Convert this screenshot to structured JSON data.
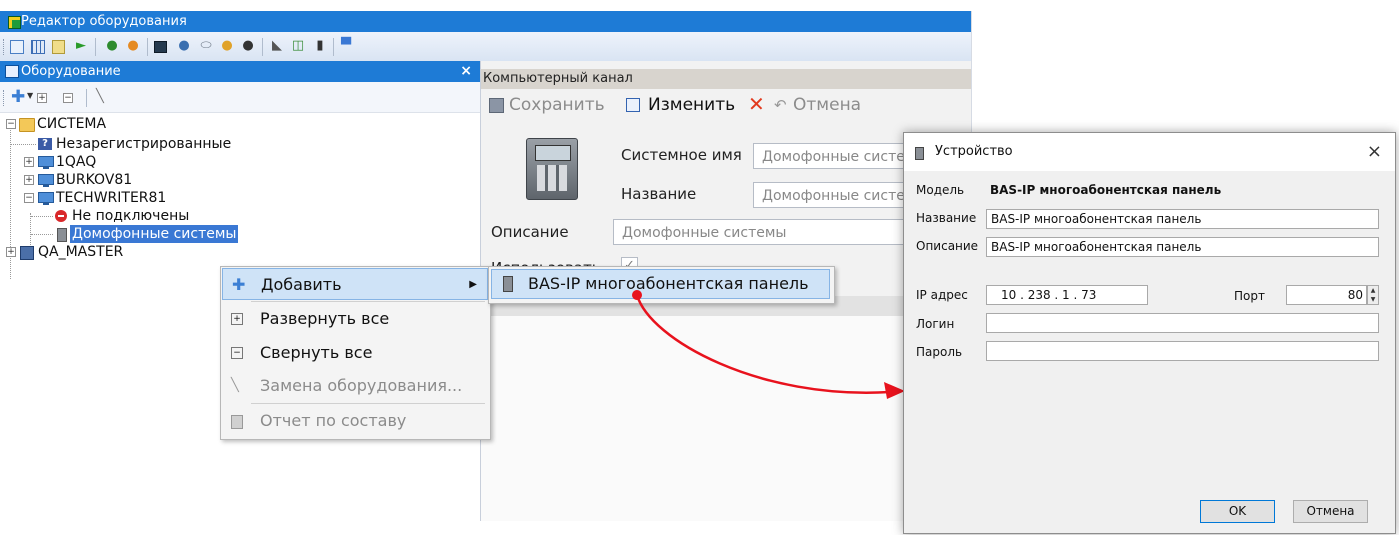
{
  "window": {
    "title": "Редактор оборудования",
    "icon": "equipment-editor-icon"
  },
  "toolbar": {
    "icons": [
      "table-icon",
      "grid-icon",
      "notes-icon",
      "flag-icon",
      "user-icon",
      "group-icon",
      "monitor-icon",
      "users-icon",
      "drive-icon",
      "person-icon",
      "person-dark-icon",
      "tool-icon",
      "card-icon",
      "phone-icon",
      "computer-icon"
    ]
  },
  "left_panel": {
    "title": "Оборудование",
    "close": "×",
    "tree": {
      "root": "СИСТЕМА",
      "unregistered": "Незарегистрированные",
      "pc1": "1QAQ",
      "pc2": "BURKOV81",
      "pc3": "TECHWRITER81",
      "not_connected": "Не подключены",
      "intercom": "Домофонные системы",
      "server": "QA_MASTER"
    }
  },
  "right_panel": {
    "header": "Компьютерный канал",
    "save": "Сохранить",
    "edit": "Изменить",
    "cancel": "Отмена",
    "system_name_label": "Системное имя",
    "system_name_value": "Домофонные системы",
    "name_label": "Название",
    "name_value": "Домофонные системы",
    "description_label": "Описание",
    "description_value": "Домофонные системы",
    "use_label": "Использовать",
    "use_checked": "✓"
  },
  "context_menu": {
    "items": [
      {
        "label": "Добавить",
        "arrow": "▶"
      },
      {
        "label": "Развернуть все"
      },
      {
        "label": "Свернуть все"
      },
      {
        "label": "Замена оборудования..."
      },
      {
        "label": "Отчет по составу"
      }
    ],
    "submenu_item": "BAS-IP многоабонентская панель"
  },
  "dialog": {
    "title": "Устройство",
    "close": "×",
    "model_label": "Модель",
    "model_value": "BAS-IP многоабонентская панель",
    "name_label": "Название",
    "name_value": "BAS-IP многоабонентская панель",
    "description_label": "Описание",
    "description_value": "BAS-IP многоабонентская панель",
    "ip_label": "IP адрес",
    "ip_value": "10 . 238 . 1 . 73",
    "port_label": "Порт",
    "port_value": "80",
    "login_label": "Логин",
    "password_label": "Пароль",
    "ok": "OK",
    "cancel": "Отмена"
  },
  "colors": {
    "titlebar": "#1e7bd6",
    "selection": "#3a78d4",
    "menu_hover": "#cfe3f7",
    "arrow": "#e8121d"
  }
}
